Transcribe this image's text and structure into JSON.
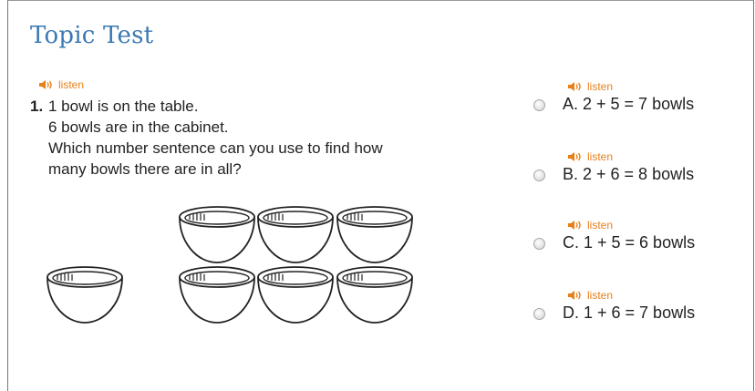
{
  "page": {
    "title": "Topic Test"
  },
  "listen_label": "listen",
  "accent_colors": {
    "title": "#3b78b3",
    "listen": "#e8801a"
  },
  "question": {
    "number": "1.",
    "lines": [
      "1 bowl is on the table.",
      "6 bowls are in the cabinet.",
      "Which number sentence can you use to find how",
      "many bowls there are in all?"
    ],
    "illustration": {
      "bowls_on_table": 1,
      "bowls_in_cabinet": 6
    }
  },
  "answers": [
    {
      "text": "A. 2 + 5 = 7 bowls"
    },
    {
      "text": "B. 2 + 6 = 8 bowls"
    },
    {
      "text": "C. 1 + 5 = 6 bowls"
    },
    {
      "text": "D. 1 + 6 = 7 bowls"
    }
  ]
}
